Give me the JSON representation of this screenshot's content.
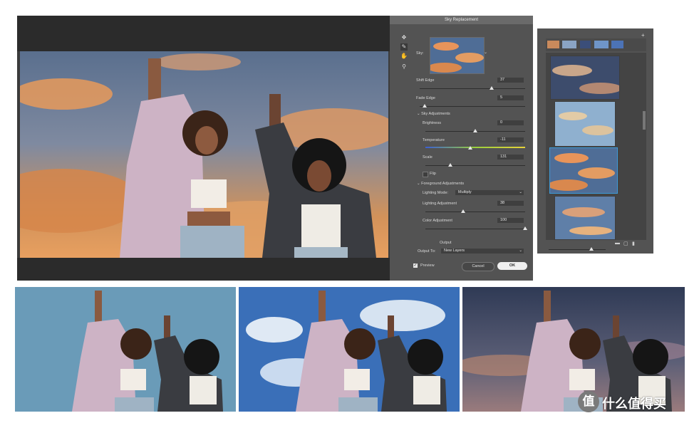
{
  "dialog": {
    "title": "Sky Replacement",
    "sky_label": "Sky:",
    "shift_edge": {
      "label": "Shift Edge",
      "value": "37",
      "level": 0.68
    },
    "fade_edge": {
      "label": "Fade Edge",
      "value": "5",
      "level": 0.05
    },
    "sky_adjustments": {
      "header": "Sky Adjustments",
      "brightness": {
        "label": "Brightness",
        "value": "0",
        "level": 0.5
      },
      "temperature": {
        "label": "Temperature",
        "value": "-11",
        "level": 0.45
      },
      "scale": {
        "label": "Scale",
        "value": "131",
        "level": 0.25
      },
      "flip_label": "Flip"
    },
    "foreground_adjustments": {
      "header": "Foreground Adjustments",
      "lighting_mode_label": "Lighting Mode:",
      "lighting_mode_value": "Multiply",
      "lighting_adjustment": {
        "label": "Lighting Adjustment",
        "value": "38",
        "level": 0.38
      },
      "color_adjustment": {
        "label": "Color Adjustment",
        "value": "100",
        "level": 1.0
      }
    },
    "output": {
      "header": "Output",
      "output_to_label": "Output To:",
      "output_to_value": "New Layers"
    },
    "preview_label": "Preview",
    "cancel_label": "Cancel",
    "ok_label": "OK"
  },
  "watermark": {
    "logo_char": "值",
    "text": "什么值得买"
  },
  "colors": {
    "dialog_bg": "#535353",
    "selection_border": "#3d9ad6",
    "ok_button": "#f0f0f0"
  },
  "icons": [
    "move-icon",
    "sky-brush-icon",
    "hand-icon",
    "zoom-icon",
    "plus-icon",
    "folder-icon",
    "new-icon",
    "trash-icon"
  ]
}
